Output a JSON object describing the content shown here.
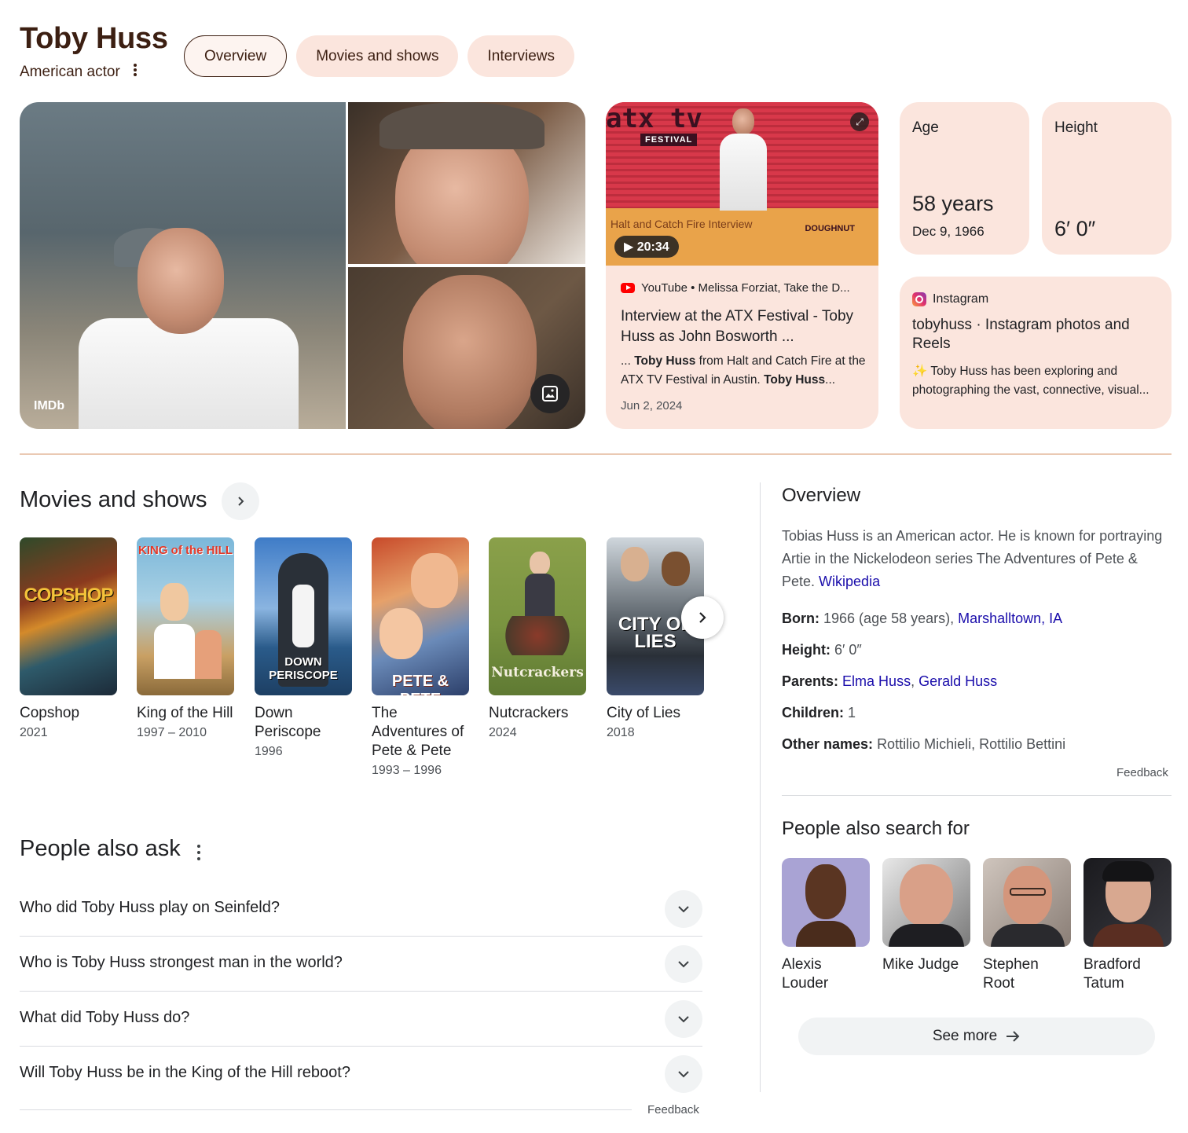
{
  "header": {
    "title": "Toby Huss",
    "subtitle": "American actor",
    "tabs": [
      {
        "label": "Overview",
        "active": true
      },
      {
        "label": "Movies and shows",
        "active": false
      },
      {
        "label": "Interviews",
        "active": false
      }
    ]
  },
  "gallery": {
    "source_label": "IMDb"
  },
  "video": {
    "thumb_logo": "atx tv",
    "thumb_badge": "FESTIVAL",
    "thumb_caption": "Halt and Catch Fire Interview",
    "thumb_brand": "DOUGHNUT",
    "duration": "20:34",
    "source": "YouTube • Melissa Forziat, Take the D...",
    "title": "Interview at the ATX Festival - Toby Huss as John Bosworth ...",
    "snippet_prefix": "... ",
    "snippet_bold1": "Toby Huss",
    "snippet_mid": " from Halt and Catch Fire at the ATX TV Festival in Austin. ",
    "snippet_bold2": "Toby Huss",
    "snippet_suffix": "...",
    "date": "Jun 2, 2024"
  },
  "stats": {
    "age": {
      "label": "Age",
      "value": "58 years",
      "sub": "Dec 9, 1966"
    },
    "height": {
      "label": "Height",
      "value": "6′ 0″"
    }
  },
  "instagram": {
    "source": "Instagram",
    "title": "tobyhuss · Instagram photos and Reels",
    "snippet": "Toby Huss has been exploring and photographing the vast, connective, visual..."
  },
  "movies": {
    "title": "Movies and shows",
    "items": [
      {
        "title": "Copshop",
        "year": "2021",
        "poster_text": "COPSHOP"
      },
      {
        "title": "King of the Hill",
        "year": "1997 – 2010",
        "poster_text": "KING of the HILL"
      },
      {
        "title": "Down Periscope",
        "year": "1996",
        "poster_text": "DOWN PERISCOPE"
      },
      {
        "title": "The Adventures of Pete & Pete",
        "year": "1993 – 1996",
        "poster_text": "PETE & PETE"
      },
      {
        "title": "Nutcrackers",
        "year": "2024",
        "poster_text": "Nutcrackers"
      },
      {
        "title": "City of Lies",
        "year": "2018",
        "poster_text": "CITY OF LIES"
      }
    ]
  },
  "paa": {
    "title": "People also ask",
    "questions": [
      "Who did Toby Huss play on Seinfeld?",
      "Who is Toby Huss strongest man in the world?",
      "What did Toby Huss do?",
      "Will Toby Huss be in the King of the Hill reboot?"
    ],
    "feedback": "Feedback"
  },
  "overview": {
    "title": "Overview",
    "description": "Tobias Huss is an American actor. He is known for portraying Artie in the Nickelodeon series The Adventures of Pete & Pete.",
    "source_link": "Wikipedia",
    "born_label": "Born:",
    "born_value": "1966 (age 58 years),",
    "born_place": "Marshalltown, IA",
    "height_label": "Height:",
    "height_value": "6′ 0″",
    "parents_label": "Parents:",
    "parent1": "Elma Huss",
    "parent2": "Gerald Huss",
    "children_label": "Children:",
    "children_value": "1",
    "other_label": "Other names:",
    "other_value": "Rottilio Michieli, Rottilio Bettini",
    "feedback": "Feedback"
  },
  "people_also_search": {
    "title": "People also search for",
    "people": [
      {
        "name": "Alexis Louder"
      },
      {
        "name": "Mike Judge"
      },
      {
        "name": "Stephen Root"
      },
      {
        "name": "Bradford Tatum"
      }
    ],
    "see_more": "See more"
  },
  "colors": {
    "accent_bg": "#fbe5dd",
    "title_brown": "#3c1f12",
    "link_blue": "#1a0dab"
  }
}
